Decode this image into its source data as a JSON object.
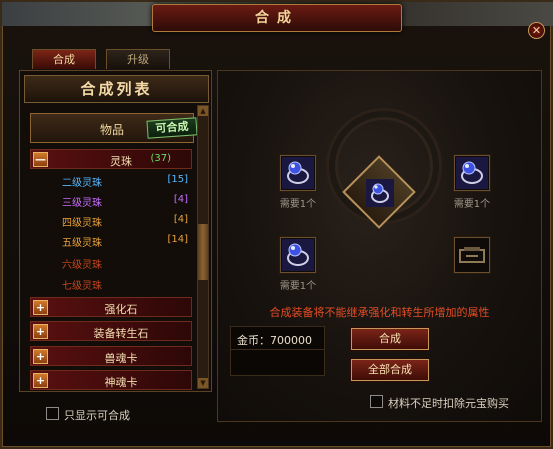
{
  "window": {
    "title": "合成",
    "close_glyph": "✕"
  },
  "tabs": [
    {
      "label": "合成",
      "active": true
    },
    {
      "label": "升级",
      "active": false
    }
  ],
  "list": {
    "header": "合成列表",
    "item": {
      "name": "物品",
      "badge": "可合成"
    },
    "categories": [
      {
        "label": "灵珠",
        "count": "(37)",
        "toggle": "—",
        "expanded": true
      },
      {
        "label": "强化石",
        "toggle": "+"
      },
      {
        "label": "装备转生石",
        "toggle": "+"
      },
      {
        "label": "兽魂卡",
        "toggle": "+"
      },
      {
        "label": "神魂卡",
        "toggle": "+"
      }
    ],
    "sub_items": [
      {
        "name": "二级灵珠",
        "count": "[15]",
        "color": "#56b8ff"
      },
      {
        "name": "三级灵珠",
        "count": "[4]",
        "color": "#c86dff"
      },
      {
        "name": "四级灵珠",
        "count": "[4]",
        "color": "#e8a23a"
      },
      {
        "name": "五级灵珠",
        "count": "[14]",
        "color": "#e8a23a"
      },
      {
        "name": "六级灵珠",
        "count": "",
        "color": "#c4461e"
      },
      {
        "name": "七级灵珠",
        "count": "",
        "color": "#c4461e"
      }
    ],
    "only_show_label": "只显示可合成",
    "scroll_up": "▲",
    "scroll_down": "▼"
  },
  "craft": {
    "need_text": "需要1个",
    "warning": "合成装备将不能继承强化和转生所增加的属性",
    "gold_label": "金币：700000",
    "craft_button": "合成",
    "craft_all_button": "全部合成",
    "deduct_label": "材料不足时扣除元宝购买"
  },
  "colors": {
    "accent_red": "#7a2418",
    "gold_text": "#f4dba8",
    "count_green": "#63e063",
    "warning_red": "#e34d26"
  }
}
